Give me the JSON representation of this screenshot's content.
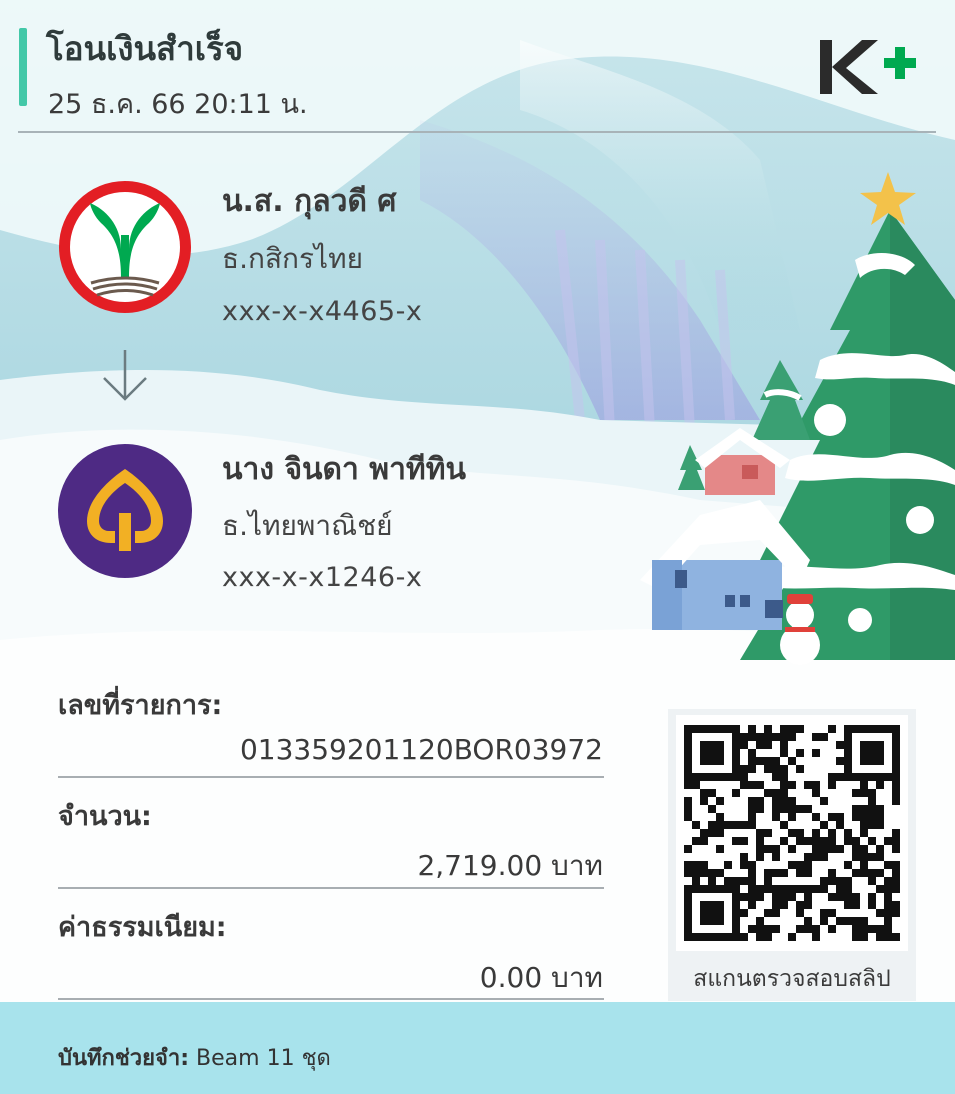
{
  "header": {
    "title": "โอนเงินสำเร็จ",
    "datetime": "25 ธ.ค. 66  20:11 น."
  },
  "brand": {
    "logo_text": "K+",
    "logo_colors": [
      "#2b2b2b",
      "#00a950"
    ]
  },
  "sender": {
    "name": "น.ส. กุลวดี ศ",
    "bank": "ธ.กสิกรไทย",
    "account": "xxx-x-x4465-x",
    "logo": "kasikorn-bank-logo",
    "logo_colors": [
      "#e31e24",
      "#00a950"
    ]
  },
  "receiver": {
    "name": "นาง จินดา พาทีทิน",
    "bank": "ธ.ไทยพาณิชย์",
    "account": "xxx-x-x1246-x",
    "logo": "scb-bank-logo",
    "logo_colors": [
      "#4e2a84",
      "#f2b024"
    ]
  },
  "transfer_icon": "arrow-down-icon",
  "details": {
    "ref_label": "เลขที่รายการ:",
    "ref_value": "013359201120BOR03972",
    "amount_label": "จำนวน:",
    "amount_value": "2,719.00 บาท",
    "fee_label": "ค่าธรรมเนียม:",
    "fee_value": "0.00 บาท"
  },
  "qr": {
    "caption": "สแกนตรวจสอบสลิป",
    "icon": "qr-code-icon"
  },
  "memo": {
    "label": "บันทึกช่วยจำ:",
    "value": "Beam 11 ชุด"
  },
  "theme": {
    "accent": "#43c8a8",
    "footer": "#a8e3ec"
  }
}
